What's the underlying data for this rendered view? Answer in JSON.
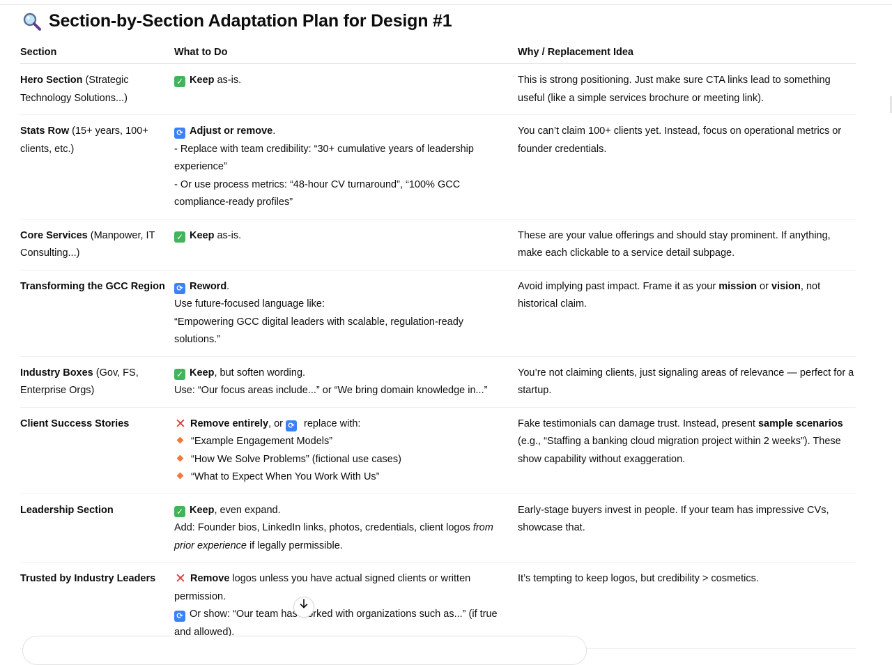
{
  "heading": {
    "title": "Section-by-Section Adaptation Plan for Design #1",
    "icon": "magnifier-icon"
  },
  "table": {
    "headers": [
      "Section",
      "What to Do",
      "Why / Replacement Idea"
    ],
    "rows": [
      {
        "section_bold": "Hero Section",
        "section_rest": " (Strategic Technology Solutions...)",
        "todo": [
          {
            "icon": "check-icon",
            "bold": "Keep",
            "rest": " as-is."
          }
        ],
        "why": "This is strong positioning. Just make sure CTA links lead to something useful (like a simple services brochure or meeting link)."
      },
      {
        "section_bold": "Stats Row",
        "section_rest": " (15+ years, 100+ clients, etc.)",
        "todo": [
          {
            "icon": "cycle-icon",
            "bold": "Adjust or remove",
            "rest": "."
          },
          {
            "text": "- Replace with team credibility: “30+ cumulative years of leadership experience”"
          },
          {
            "text": "- Or use process metrics: “48-hour CV turnaround”, “100% GCC compliance-ready profiles”"
          }
        ],
        "why": "You can’t claim 100+ clients yet. Instead, focus on operational metrics or founder credentials."
      },
      {
        "section_bold": "Core Services",
        "section_rest": " (Manpower, IT Consulting...)",
        "todo": [
          {
            "icon": "check-icon",
            "bold": "Keep",
            "rest": " as-is."
          }
        ],
        "why": "These are your value offerings and should stay prominent. If anything, make each clickable to a service detail subpage."
      },
      {
        "section_bold": "Transforming the GCC Region",
        "section_rest": "",
        "todo": [
          {
            "icon": "cycle-icon",
            "bold": "Reword",
            "rest": "."
          },
          {
            "text": "Use future-focused language like:"
          },
          {
            "text": "“Empowering GCC digital leaders with scalable, regulation-ready solutions.”"
          }
        ],
        "why_parts": [
          {
            "t": "Avoid implying past impact. Frame it as your "
          },
          {
            "t": "mission",
            "b": true
          },
          {
            "t": " or "
          },
          {
            "t": "vision",
            "b": true
          },
          {
            "t": ", not historical claim."
          }
        ]
      },
      {
        "section_bold": "Industry Boxes",
        "section_rest": " (Gov, FS, Enterprise Orgs)",
        "todo": [
          {
            "icon": "check-icon",
            "bold": "Keep",
            "rest": ", but soften wording."
          },
          {
            "text": "Use: “Our focus areas include...” or “We bring domain knowledge in...”"
          }
        ],
        "why": "You’re not claiming clients, just signaling areas of relevance — perfect for a startup."
      },
      {
        "section_bold": "Client Success Stories",
        "section_rest": "",
        "todo": [
          {
            "icon": "cross-icon",
            "bold": "Remove entirely",
            "rest": ", or ",
            "icon2": "cycle-icon",
            "rest2": " replace with:"
          },
          {
            "bullet": "“Example Engagement Models”"
          },
          {
            "bullet": "“How We Solve Problems” (fictional use cases)"
          },
          {
            "bullet": "“What to Expect When You Work With Us”"
          }
        ],
        "why_parts": [
          {
            "t": "Fake testimonials can damage trust. Instead, present "
          },
          {
            "t": "sample scenarios",
            "b": true
          },
          {
            "t": " (e.g., “Staffing a banking cloud migration project within 2 weeks”). These show capability without exaggeration."
          }
        ]
      },
      {
        "section_bold": "Leadership Section",
        "section_rest": "",
        "todo": [
          {
            "icon": "check-icon",
            "bold": "Keep",
            "rest": ", even expand."
          },
          {
            "parts": [
              {
                "t": "Add: Founder bios, LinkedIn links, photos, credentials, client logos "
              },
              {
                "t": "from prior experience",
                "i": true
              },
              {
                "t": " if legally permissible."
              }
            ]
          }
        ],
        "why": "Early-stage buyers invest in people. If your team has impressive CVs, showcase that."
      },
      {
        "section_bold": "Trusted by Industry Leaders",
        "section_rest": "",
        "todo": [
          {
            "icon": "cross-icon",
            "bold": "Remove",
            "rest": " logos unless you have actual signed clients or written permission."
          },
          {
            "icon": "cycle-icon",
            "text": "Or show: “Our team has worked with organizations such as...” (if true and allowed)."
          }
        ],
        "why": "It’s tempting to keep logos, but credibility > cosmetics."
      }
    ]
  },
  "scroll_button": {
    "icon": "arrow-down-icon"
  }
}
